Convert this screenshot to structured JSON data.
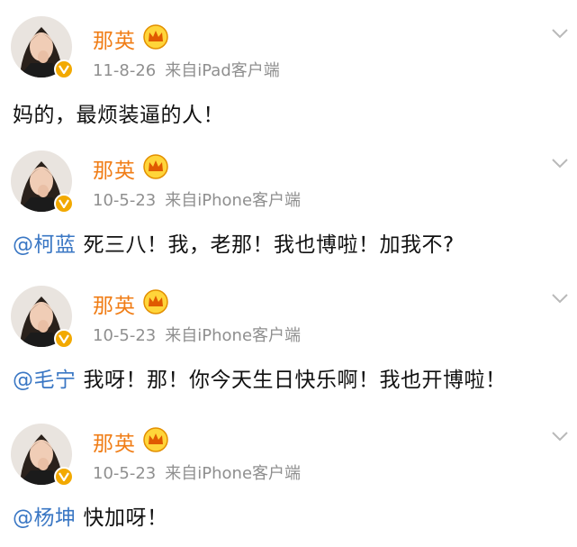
{
  "posts": [
    {
      "user_name": "那英",
      "date": "11-8-26",
      "source": "来自iPad客户端",
      "mention": "",
      "text": "妈的，最烦装逼的人！"
    },
    {
      "user_name": "那英",
      "date": "10-5-23",
      "source": "来自iPhone客户端",
      "mention": "@柯蓝",
      "text": "死三八！我，老那！我也博啦！加我不?"
    },
    {
      "user_name": "那英",
      "date": "10-5-23",
      "source": "来自iPhone客户端",
      "mention": "@毛宁",
      "text": "我呀！那！你今天生日快乐啊！我也开博啦！"
    },
    {
      "user_name": "那英",
      "date": "10-5-23",
      "source": "来自iPhone客户端",
      "mention": "@杨坤",
      "text": "快加呀！"
    }
  ],
  "icons": {
    "avatar": "avatar-image",
    "verified_badge": "verified-v-icon",
    "crown": "crown-icon",
    "more": "chevron-down-icon"
  },
  "colors": {
    "name": "#f07d16",
    "mention": "#3a77c4",
    "meta": "#8f8f8f",
    "text": "#111111",
    "badge": "#f2a900"
  }
}
